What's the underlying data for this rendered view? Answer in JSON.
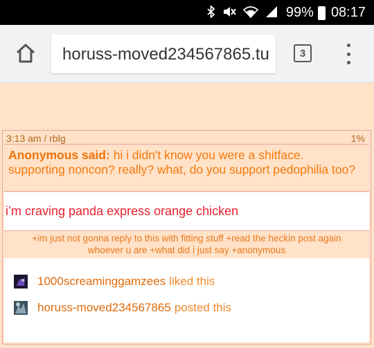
{
  "status_bar": {
    "battery_percent": "99%",
    "time": "08:17",
    "icons": [
      "bluetooth-icon",
      "mute-icon",
      "wifi-icon",
      "signal-icon",
      "battery-icon"
    ]
  },
  "browser": {
    "url": "horuss-moved234567865.tu",
    "tab_count": "3"
  },
  "post": {
    "meta": {
      "time": "3:13 am / rblg",
      "note_count": "1%"
    },
    "ask": {
      "asker": "Anonymous said:",
      "question": "hi i didn't know you were a shitface. supporting noncon? really? what, do you support pedophilia too?"
    },
    "answer": "i’m craving panda express orange chicken",
    "tags_line1": "+im just not gonna reply to this with fitting stuff +read the heckin post again",
    "tags_line2": "whoever u are +what did i just say +anonymous",
    "notes": [
      {
        "user": "1000screaminggamzees",
        "action": "liked this"
      },
      {
        "user": "horuss-moved234567865",
        "action": "posted this"
      }
    ]
  },
  "colors": {
    "page_bg": "#ffe2c8",
    "border": "#e8a3a3",
    "ask_text": "#f5790d",
    "answer_text": "#e8202e",
    "tags_text": "#e8791e"
  }
}
